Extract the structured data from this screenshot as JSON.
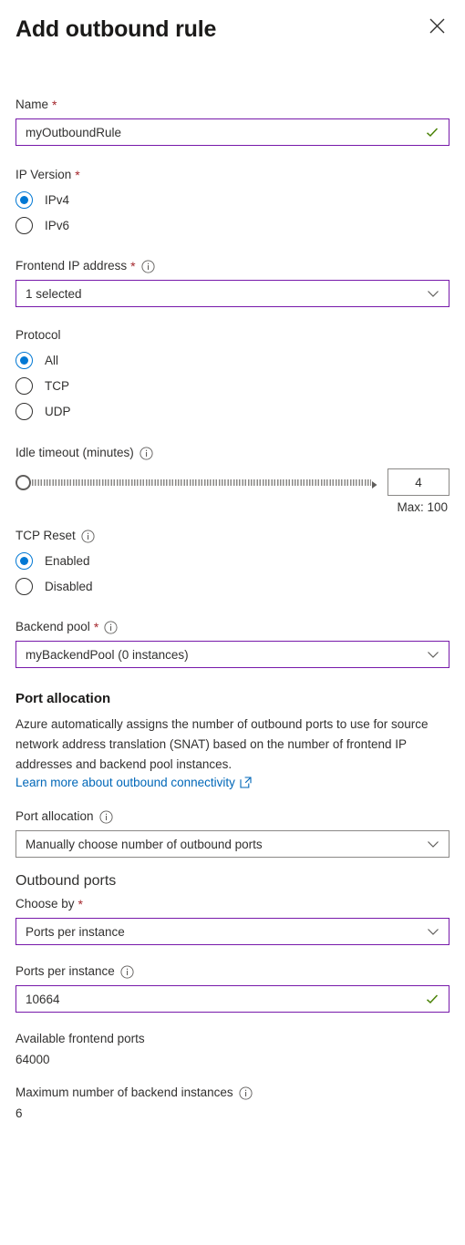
{
  "header": {
    "title": "Add outbound rule",
    "close_label": "Close",
    "close_icon": "close-icon"
  },
  "name_field": {
    "label": "Name",
    "required_marker": "*",
    "value": "myOutboundRule",
    "valid_icon": "check-icon"
  },
  "ip_version": {
    "label": "IP Version",
    "required_marker": "*",
    "selected": "IPv4",
    "options": [
      {
        "label": "IPv4",
        "selected": true
      },
      {
        "label": "IPv6",
        "selected": false
      }
    ]
  },
  "frontend_ip": {
    "label": "Frontend IP address",
    "required_marker": "*",
    "info_icon": "info-icon",
    "value": "1 selected",
    "chevron_icon": "chevron-down-icon"
  },
  "protocol": {
    "label": "Protocol",
    "selected": "All",
    "options": [
      {
        "label": "All",
        "selected": true
      },
      {
        "label": "TCP",
        "selected": false
      },
      {
        "label": "UDP",
        "selected": false
      }
    ]
  },
  "idle_timeout": {
    "label": "Idle timeout (minutes)",
    "info_icon": "info-icon",
    "value": "4",
    "min": 4,
    "max": 100,
    "max_text": "Max: 100"
  },
  "tcp_reset": {
    "label": "TCP Reset",
    "info_icon": "info-icon",
    "selected": "Enabled",
    "options": [
      {
        "label": "Enabled",
        "selected": true
      },
      {
        "label": "Disabled",
        "selected": false
      }
    ]
  },
  "backend_pool": {
    "label": "Backend pool",
    "required_marker": "*",
    "info_icon": "info-icon",
    "value": "myBackendPool (0 instances)",
    "chevron_icon": "chevron-down-icon"
  },
  "port_allocation_section": {
    "heading": "Port allocation",
    "description": "Azure automatically assigns the number of outbound ports to use for source network address translation (SNAT) based on the number of frontend IP addresses and backend pool instances.",
    "link_text": "Learn more about outbound connectivity",
    "link_icon": "external-link-icon"
  },
  "port_allocation_select": {
    "label": "Port allocation",
    "info_icon": "info-icon",
    "value": "Manually choose number of outbound ports",
    "chevron_icon": "chevron-down-icon"
  },
  "outbound_ports": {
    "heading": "Outbound ports",
    "choose_by": {
      "label": "Choose by",
      "required_marker": "*",
      "value": "Ports per instance",
      "chevron_icon": "chevron-down-icon"
    },
    "ports_per_instance": {
      "label": "Ports per instance",
      "info_icon": "info-icon",
      "value": "10664",
      "valid_icon": "check-icon"
    },
    "available_frontend_ports": {
      "label": "Available frontend ports",
      "value": "64000"
    },
    "max_backend_instances": {
      "label": "Maximum number of backend instances",
      "info_icon": "info-icon",
      "value": "6"
    }
  },
  "colors": {
    "accent_blue": "#0078d4",
    "link_blue": "#0067b8",
    "required_red": "#a4262c",
    "valid_green": "#498205",
    "field_border_purple": "#7719aa",
    "field_border_gray": "#8a8886",
    "text": "#323130"
  }
}
